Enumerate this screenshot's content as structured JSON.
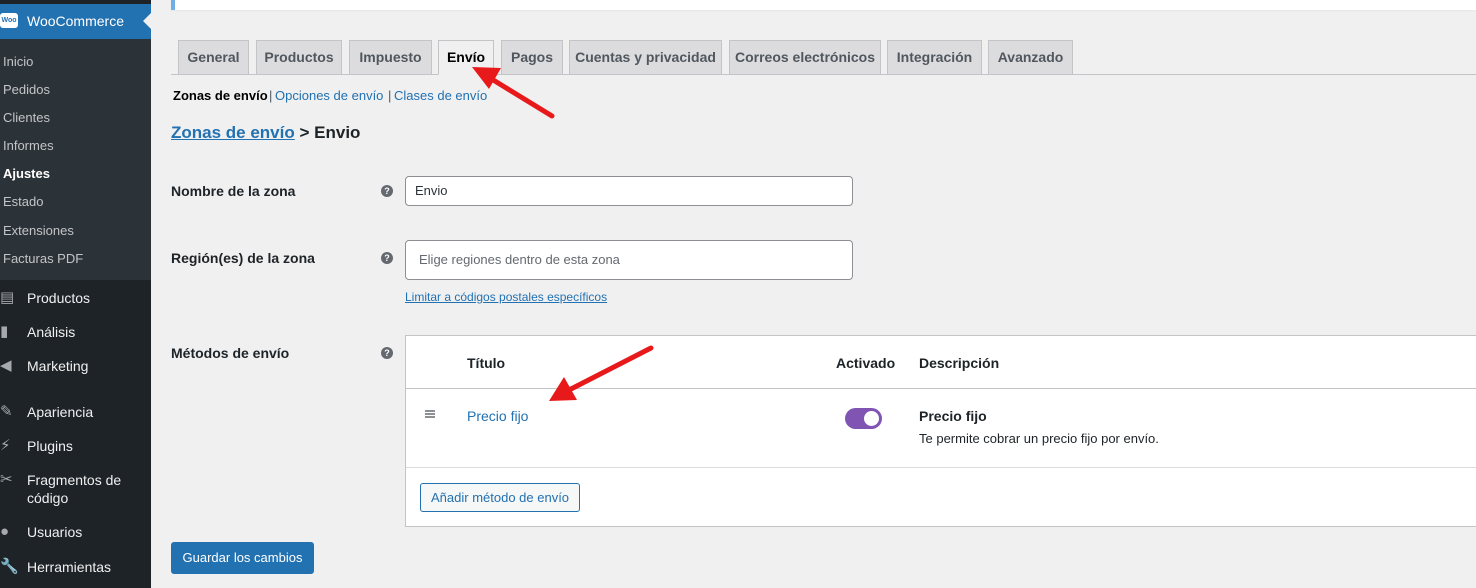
{
  "sidebar": {
    "woo_logo_text": "Woo",
    "active_menu": "WooCommerce",
    "submenu": [
      {
        "label": "Inicio",
        "active": false
      },
      {
        "label": "Pedidos",
        "active": false
      },
      {
        "label": "Clientes",
        "active": false
      },
      {
        "label": "Informes",
        "active": false
      },
      {
        "label": "Ajustes",
        "active": true
      },
      {
        "label": "Estado",
        "active": false
      },
      {
        "label": "Extensiones",
        "active": false
      },
      {
        "label": "Facturas PDF",
        "active": false
      }
    ],
    "menu": [
      {
        "label": "Productos",
        "icon": "archive-icon"
      },
      {
        "label": "Análisis",
        "icon": "bar-chart-icon"
      },
      {
        "label": "Marketing",
        "icon": "megaphone-icon"
      },
      {
        "label": "Apariencia",
        "icon": "brush-icon"
      },
      {
        "label": "Plugins",
        "icon": "plug-icon"
      },
      {
        "label": "Fragmentos de",
        "label2": "código",
        "icon": "scissors-icon"
      },
      {
        "label": "Usuarios",
        "icon": "user-icon"
      },
      {
        "label": "Herramientas",
        "icon": "wrench-icon"
      }
    ]
  },
  "tabs": [
    {
      "label": "General",
      "active": false
    },
    {
      "label": "Productos",
      "active": false
    },
    {
      "label": "Impuesto",
      "active": false
    },
    {
      "label": "Envío",
      "active": true
    },
    {
      "label": "Pagos",
      "active": false
    },
    {
      "label": "Cuentas y privacidad",
      "active": false
    },
    {
      "label": "Correos electrónicos",
      "active": false
    },
    {
      "label": "Integración",
      "active": false
    },
    {
      "label": "Avanzado",
      "active": false
    }
  ],
  "sections": {
    "current": "Zonas de envío",
    "links": [
      "Opciones de envío",
      "Clases de envío"
    ],
    "separator": "|"
  },
  "breadcrumb": {
    "parent": "Zonas de envío",
    "separator": ">",
    "current": "Envio"
  },
  "form": {
    "zone_name_label": "Nombre de la zona",
    "zone_name_value": "Envio",
    "zone_regions_label": "Región(es) de la zona",
    "zone_regions_placeholder": "Elige regiones dentro de esta zona",
    "postcode_link": "Limitar a códigos postales específicos",
    "methods_label": "Métodos de envío",
    "help_icon": "?"
  },
  "methods_table": {
    "columns": {
      "title": "Título",
      "enabled": "Activado",
      "description": "Descripción"
    },
    "rows": [
      {
        "title": "Precio fijo",
        "enabled": true,
        "desc_title": "Precio fijo",
        "desc_text": "Te permite cobrar un precio fijo por envío."
      }
    ],
    "add_button": "Añadir método de envío"
  },
  "save_button": "Guardar los cambios",
  "colors": {
    "sidebar_bg": "#1d2327",
    "accent": "#2271b1",
    "toggle_on": "#7f54b3",
    "annotation_arrow": "#e8191a"
  }
}
